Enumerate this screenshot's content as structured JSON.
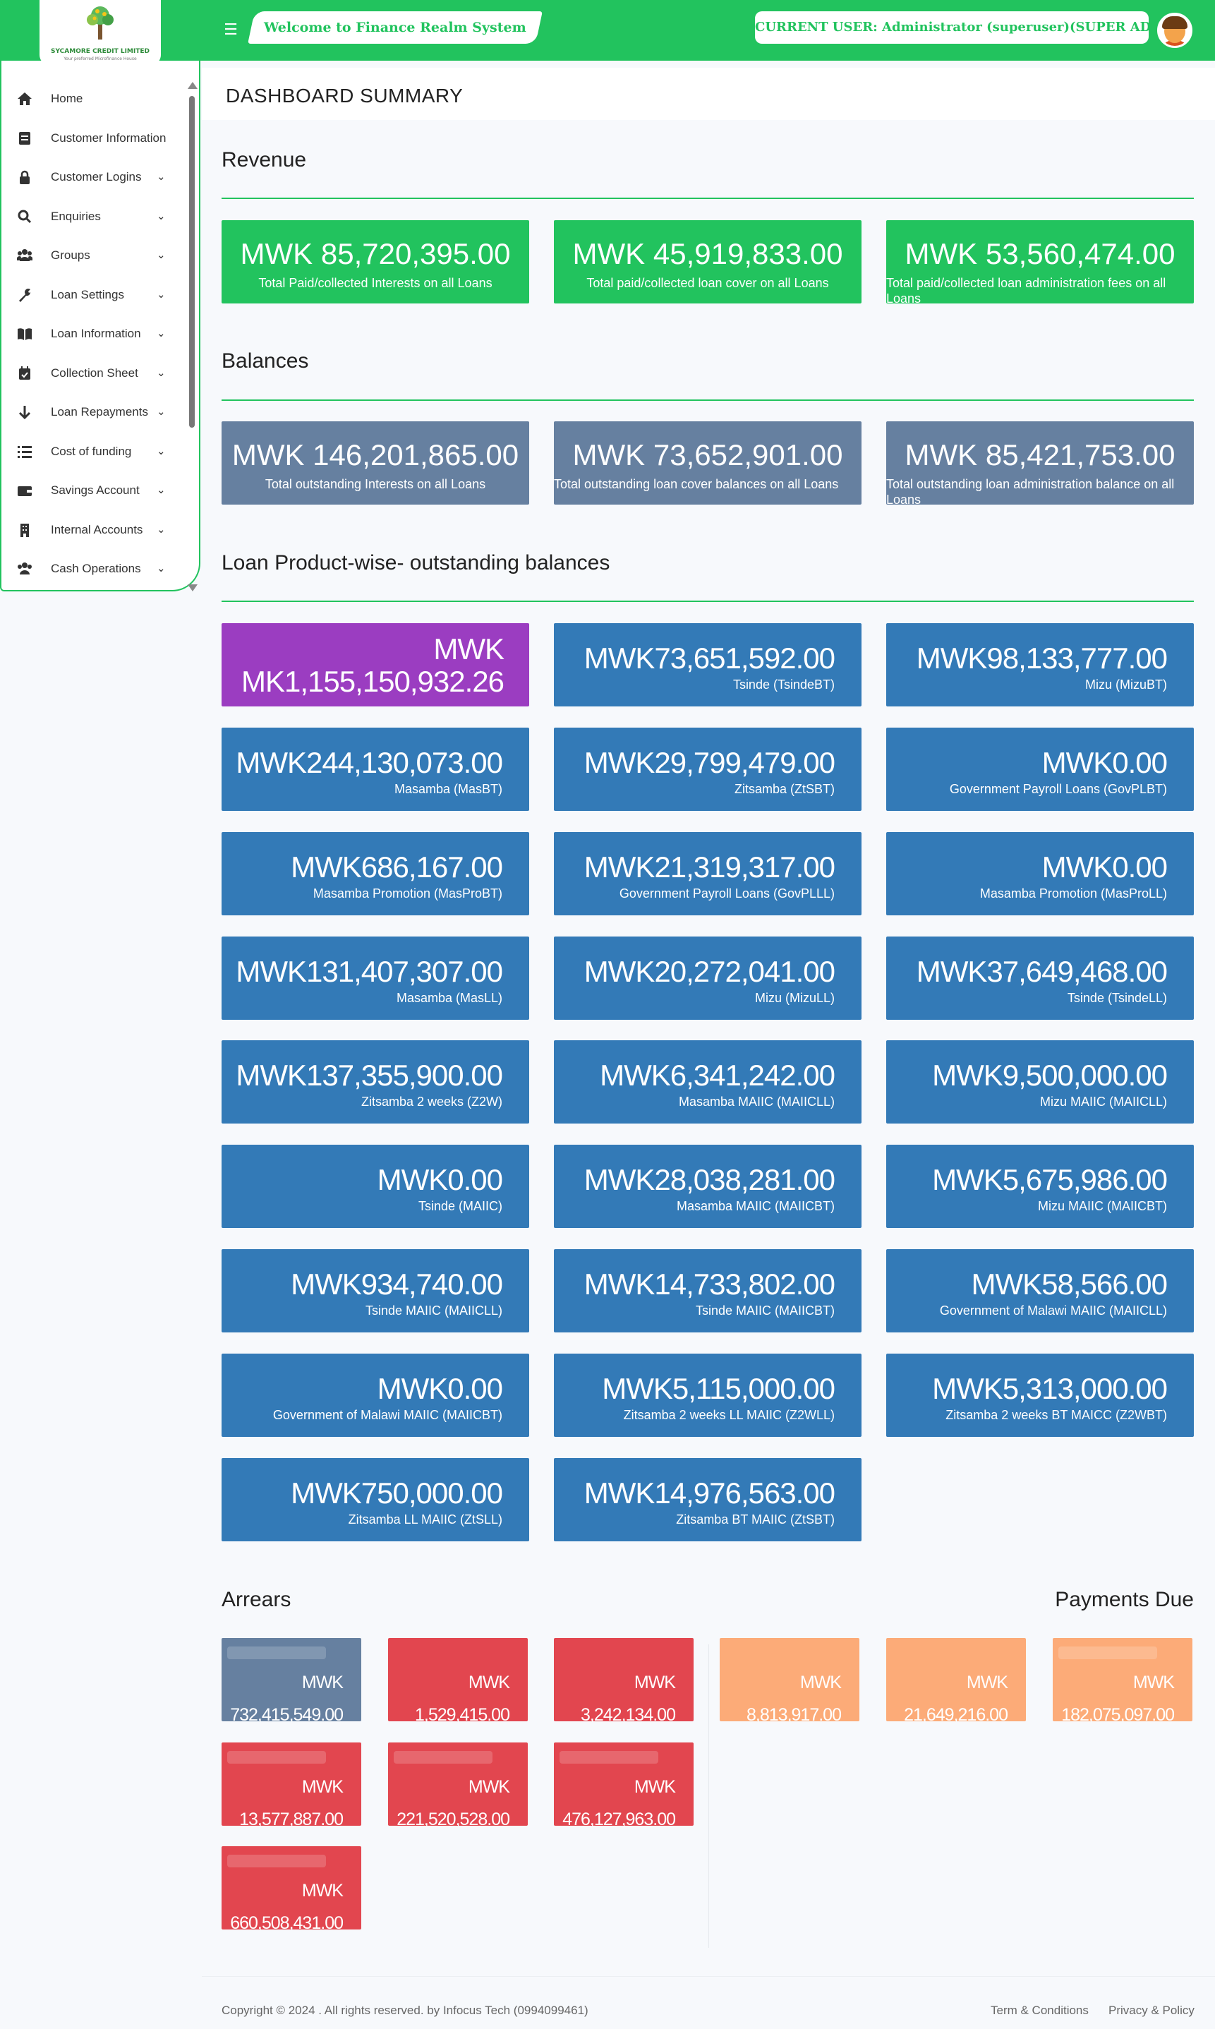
{
  "header": {
    "logo_name": "SYCAMORE CREDIT LIMITED",
    "logo_tagline": "Your preferred Microfinance House",
    "welcome": "Welcome to Finance Realm System",
    "current_user": "CURRENT USER: Administrator (superuser)(SUPER ADMIN)",
    "accent_color": "#22c35e"
  },
  "sidebar": {
    "items": [
      {
        "label": "Home",
        "icon": "home-icon",
        "chevron": false
      },
      {
        "label": "Customer Information",
        "icon": "id-card-icon",
        "chevron": true
      },
      {
        "label": "Customer Logins",
        "icon": "lock-icon",
        "chevron": true
      },
      {
        "label": "Enquiries",
        "icon": "search-icon",
        "chevron": true
      },
      {
        "label": "Groups",
        "icon": "users-icon",
        "chevron": true
      },
      {
        "label": "Loan Settings",
        "icon": "wrench-icon",
        "chevron": true
      },
      {
        "label": "Loan Information",
        "icon": "book-icon",
        "chevron": true
      },
      {
        "label": "Collection Sheet",
        "icon": "calendar-icon",
        "chevron": true
      },
      {
        "label": "Loan Repayments",
        "icon": "arrow-down-icon",
        "chevron": true
      },
      {
        "label": "Cost of funding",
        "icon": "list-icon",
        "chevron": true
      },
      {
        "label": "Savings Account",
        "icon": "wallet-icon",
        "chevron": true
      },
      {
        "label": "Internal Accounts",
        "icon": "building-icon",
        "chevron": true
      },
      {
        "label": "Cash Operations",
        "icon": "users-icon",
        "chevron": true
      }
    ]
  },
  "main": {
    "page_title": "DASHBOARD SUMMARY",
    "revenue": {
      "title": "Revenue",
      "cards": [
        {
          "amount": "MWK 85,720,395.00",
          "label": "Total Paid/collected Interests on all Loans"
        },
        {
          "amount": "MWK 45,919,833.00",
          "label": "Total paid/collected loan cover on all Loans"
        },
        {
          "amount": "MWK 53,560,474.00",
          "label": "Total paid/collected loan administration fees on all Loans"
        }
      ]
    },
    "balances": {
      "title": "Balances",
      "cards": [
        {
          "amount": "MWK 146,201,865.00",
          "label": "Total outstanding Interests on all Loans"
        },
        {
          "amount": "MWK 73,652,901.00",
          "label": "Total outstanding loan cover balances on all Loans"
        },
        {
          "amount": "MWK 85,421,753.00",
          "label": "Total outstanding loan administration balance on all Loans"
        }
      ]
    },
    "products": {
      "title": "Loan Product-wise- outstanding balances",
      "total": {
        "amount": "MWK MK1,155,150,932.26"
      },
      "cards": [
        {
          "amount": "MWK73,651,592.00",
          "label": "Tsinde (TsindeBT)"
        },
        {
          "amount": "MWK98,133,777.00",
          "label": "Mizu (MizuBT)"
        },
        {
          "amount": "MWK244,130,073.00",
          "label": "Masamba (MasBT)"
        },
        {
          "amount": "MWK29,799,479.00",
          "label": "Zitsamba (ZtSBT)"
        },
        {
          "amount": "MWK0.00",
          "label": "Government Payroll Loans (GovPLBT)"
        },
        {
          "amount": "MWK686,167.00",
          "label": "Masamba Promotion (MasProBT)"
        },
        {
          "amount": "MWK21,319,317.00",
          "label": "Government Payroll Loans (GovPLLL)"
        },
        {
          "amount": "MWK0.00",
          "label": "Masamba Promotion (MasProLL)"
        },
        {
          "amount": "MWK131,407,307.00",
          "label": "Masamba (MasLL)"
        },
        {
          "amount": "MWK20,272,041.00",
          "label": "Mizu (MizuLL)"
        },
        {
          "amount": "MWK37,649,468.00",
          "label": "Tsinde (TsindeLL)"
        },
        {
          "amount": "MWK137,355,900.00",
          "label": "Zitsamba 2 weeks (Z2W)"
        },
        {
          "amount": "MWK6,341,242.00",
          "label": "Masamba MAIIC (MAIICLL)"
        },
        {
          "amount": "MWK9,500,000.00",
          "label": "Mizu MAIIC (MAIICLL)"
        },
        {
          "amount": "MWK0.00",
          "label": "Tsinde (MAIIC)"
        },
        {
          "amount": "MWK28,038,281.00",
          "label": "Masamba MAIIC (MAIICBT)"
        },
        {
          "amount": "MWK5,675,986.00",
          "label": "Mizu MAIIC (MAIICBT)"
        },
        {
          "amount": "MWK934,740.00",
          "label": "Tsinde MAIIC (MAIICLL)"
        },
        {
          "amount": "MWK14,733,802.00",
          "label": "Tsinde MAIIC (MAIICBT)"
        },
        {
          "amount": "MWK58,566.00",
          "label": "Government of Malawi MAIIC (MAIICLL)"
        },
        {
          "amount": "MWK0.00",
          "label": "Government of Malawi MAIIC (MAIICBT)"
        },
        {
          "amount": "MWK5,115,000.00",
          "label": "Zitsamba 2 weeks LL MAIIC (Z2WLL)"
        },
        {
          "amount": "MWK5,313,000.00",
          "label": "Zitsamba 2 weeks BT MAICC (Z2WBT)"
        },
        {
          "amount": "MWK750,000.00",
          "label": "Zitsamba LL MAIIC (ZtSLL)"
        },
        {
          "amount": "MWK14,976,563.00",
          "label": "Zitsamba BT MAIIC (ZtSBT)"
        }
      ]
    },
    "arrears": {
      "title": "Arrears",
      "cards": [
        {
          "amount": "MWK 732,415,549.00",
          "color": "#6680a0"
        },
        {
          "amount": "MWK 1,529,415.00",
          "color": "#e2464f"
        },
        {
          "amount": "MWK 3,242,134.00",
          "color": "#e2464f"
        },
        {
          "amount": "MWK 13,577,887.00",
          "color": "#e2464f"
        },
        {
          "amount": "MWK 221,520,528.00",
          "color": "#e2464f"
        },
        {
          "amount": "MWK 476,127,963.00",
          "color": "#e2464f"
        },
        {
          "amount": "MWK 660,508,431.00",
          "color": "#e2464f"
        }
      ]
    },
    "payments_due": {
      "title": "Payments Due",
      "cards": [
        {
          "amount": "MWK 8,813,917.00",
          "color": "#fcab78"
        },
        {
          "amount": "MWK 21,649,216.00",
          "color": "#fcab78"
        },
        {
          "amount": "MWK 182,075,097.00",
          "color": "#fcab78"
        }
      ]
    }
  },
  "footer": {
    "copyright": "Copyright © 2024 . All rights reserved. by Infocus Tech (0994099461)",
    "terms": "Term & Conditions",
    "privacy": "Privacy & Policy"
  }
}
